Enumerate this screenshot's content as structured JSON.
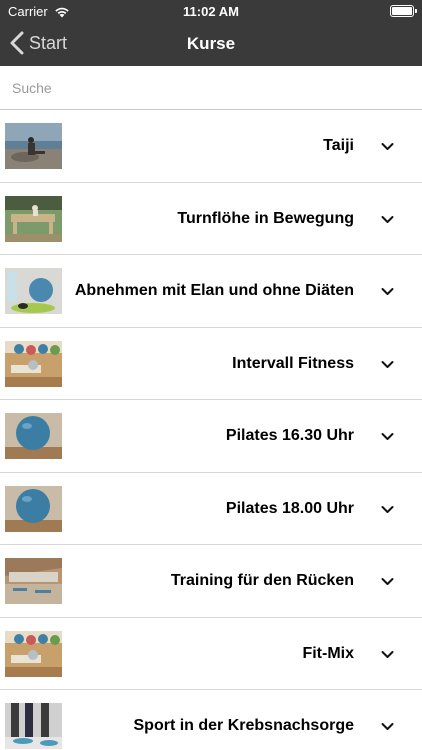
{
  "status_bar": {
    "carrier": "Carrier",
    "time": "11:02 AM",
    "wifi_icon": "wifi-icon",
    "battery_icon": "battery-icon"
  },
  "nav": {
    "back_label": "Start",
    "title": "Kurse",
    "back_icon": "chevron-left-icon",
    "background_color": "#3a3a3a"
  },
  "search": {
    "placeholder": "Suche",
    "value": ""
  },
  "courses": [
    {
      "title": "Taiji",
      "thumbnail": "photo-taiji"
    },
    {
      "title": "Turnflöhe in Bewegung",
      "thumbnail": "photo-gym-hall"
    },
    {
      "title": "Abnehmen mit Elan und ohne Diäten",
      "thumbnail": "photo-fitness-equipment"
    },
    {
      "title": "Intervall Fitness",
      "thumbnail": "photo-gym-balls"
    },
    {
      "title": "Pilates 16.30 Uhr",
      "thumbnail": "photo-pilates-ball"
    },
    {
      "title": "Pilates 18.00 Uhr",
      "thumbnail": "photo-pilates-ball"
    },
    {
      "title": "Training für den Rücken",
      "thumbnail": "photo-gym-room"
    },
    {
      "title": "Fit-Mix",
      "thumbnail": "photo-gym-balls"
    },
    {
      "title": "Sport in der Krebsnachsorge",
      "thumbnail": "photo-exercise-class"
    }
  ],
  "expand_icon": "chevron-down-icon"
}
